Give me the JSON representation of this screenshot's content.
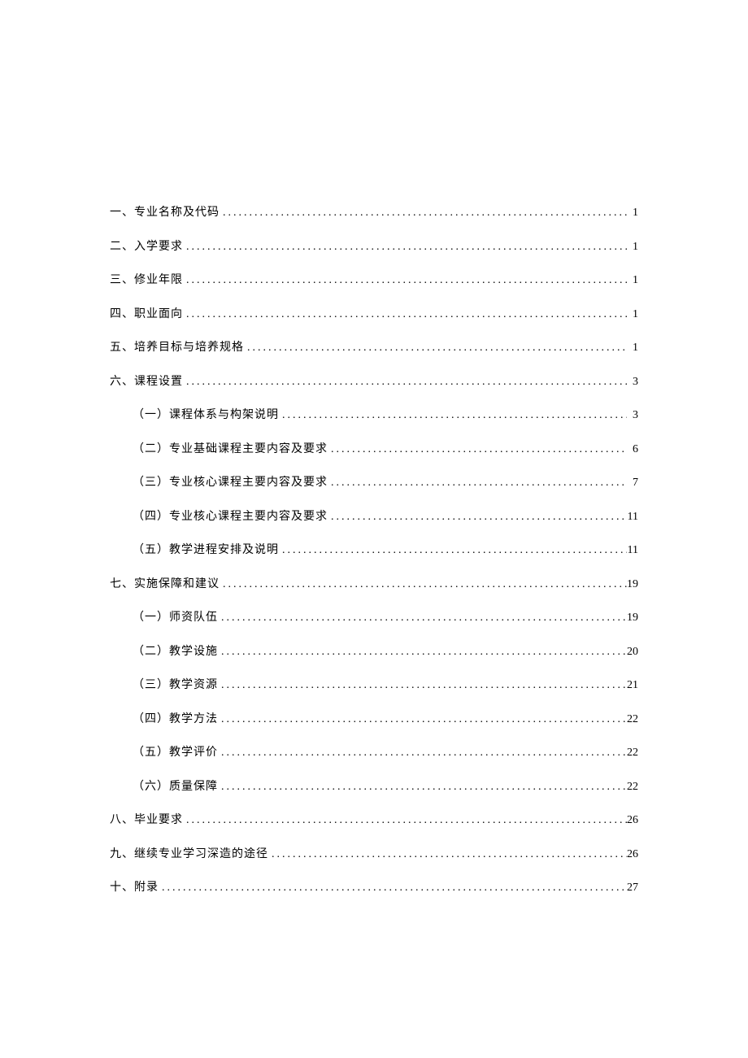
{
  "toc": [
    {
      "label": "一、专业名称及代码",
      "page": "1",
      "indent": false
    },
    {
      "label": "二、入学要求",
      "page": "1",
      "indent": false
    },
    {
      "label": "三、修业年限",
      "page": "1",
      "indent": false
    },
    {
      "label": "四、职业面向",
      "page": "1",
      "indent": false
    },
    {
      "label": "五、培养目标与培养规格",
      "page": "1",
      "indent": false
    },
    {
      "label": "六、课程设置",
      "page": "3",
      "indent": false
    },
    {
      "label": "（一）课程体系与构架说明",
      "page": "3",
      "indent": true
    },
    {
      "label": "（二）专业基础课程主要内容及要求",
      "page": "6",
      "indent": true
    },
    {
      "label": "（三）专业核心课程主要内容及要求",
      "page": "7",
      "indent": true
    },
    {
      "label": "（四）专业核心课程主要内容及要求",
      "page": "11",
      "indent": true
    },
    {
      "label": "（五）教学进程安排及说明",
      "page": "11",
      "indent": true
    },
    {
      "label": "七、实施保障和建议",
      "page": "19",
      "indent": false
    },
    {
      "label": "（一）师资队伍",
      "page": "19",
      "indent": true
    },
    {
      "label": "（二）教学设施",
      "page": "20",
      "indent": true
    },
    {
      "label": "（三）教学资源",
      "page": "21",
      "indent": true
    },
    {
      "label": "（四）教学方法",
      "page": "22",
      "indent": true
    },
    {
      "label": "（五）教学评价",
      "page": "22",
      "indent": true
    },
    {
      "label": "（六）质量保障",
      "page": "22",
      "indent": true
    },
    {
      "label": "八、毕业要求",
      "page": "26",
      "indent": false
    },
    {
      "label": "九、继续专业学习深造的途径",
      "page": "26",
      "indent": false
    },
    {
      "label": "十、附录",
      "page": "27",
      "indent": false
    }
  ]
}
